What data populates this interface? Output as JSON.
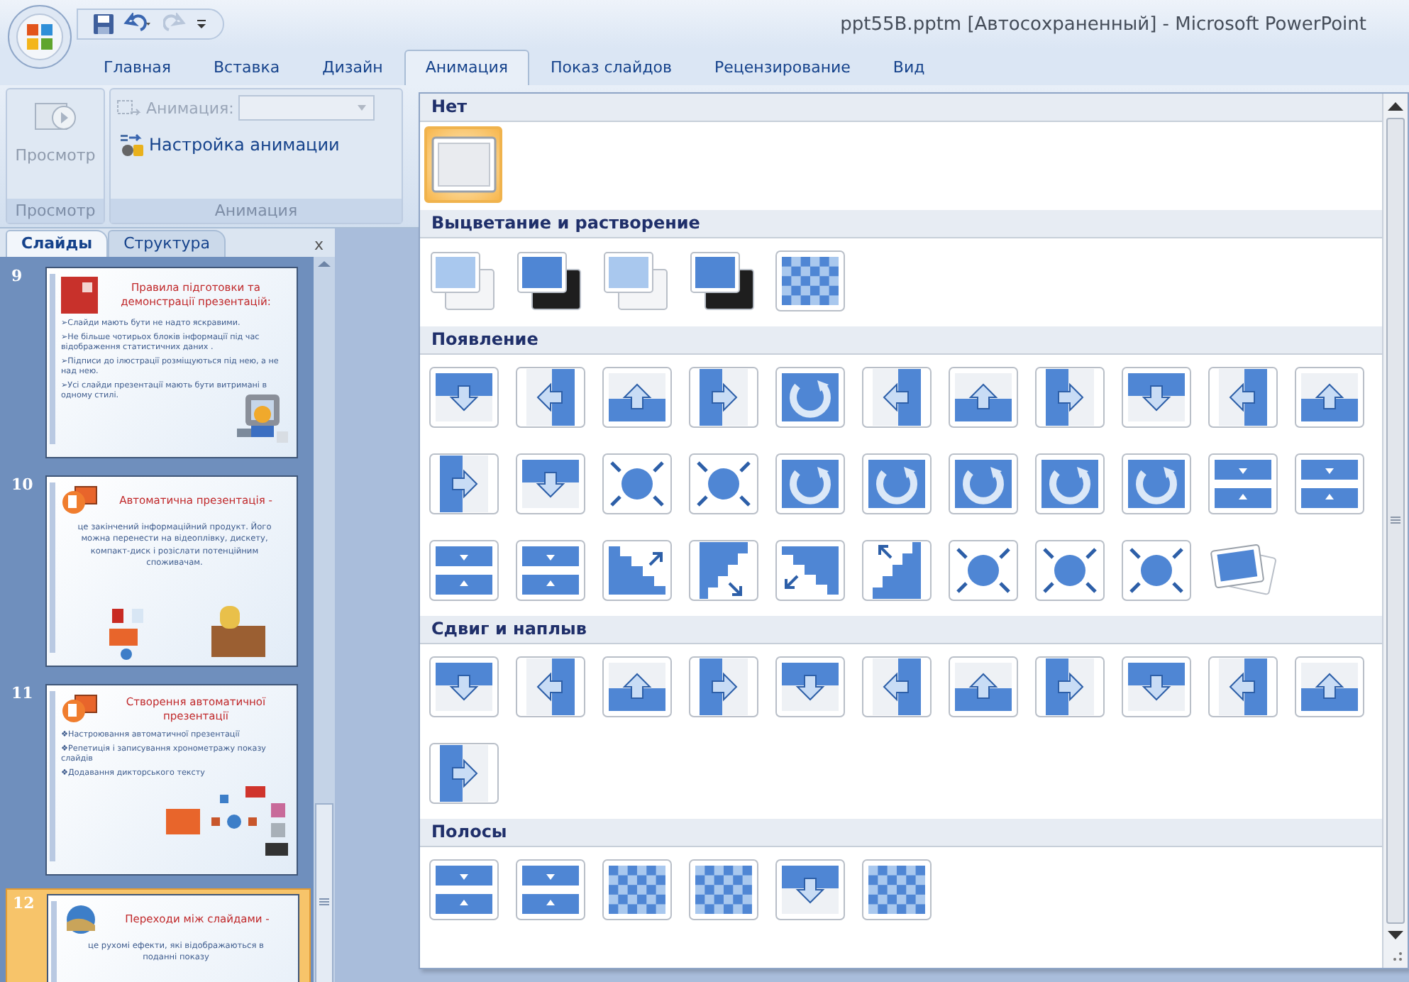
{
  "title_bar": {
    "title": "ppt55B.pptm [Автосохраненный] - Microsoft PowerPoint"
  },
  "ribbon_tabs": [
    {
      "label": "Главная",
      "selected": false
    },
    {
      "label": "Вставка",
      "selected": false
    },
    {
      "label": "Дизайн",
      "selected": false
    },
    {
      "label": "Анимация",
      "selected": true
    },
    {
      "label": "Показ слайдов",
      "selected": false
    },
    {
      "label": "Рецензирование",
      "selected": false
    },
    {
      "label": "Вид",
      "selected": false
    }
  ],
  "ribbon": {
    "groups": [
      {
        "label": "Просмотр",
        "controls": [
          {
            "kind": "large-button",
            "label": "Просмотр",
            "disabled": true
          }
        ]
      },
      {
        "label": "Анимация",
        "controls": [
          {
            "kind": "combo",
            "label": "Анимация:",
            "disabled": true
          },
          {
            "kind": "button",
            "label": "Настройка анимации",
            "disabled": false
          }
        ]
      }
    ]
  },
  "pane": {
    "tabs": [
      {
        "label": "Слайды",
        "selected": true
      },
      {
        "label": "Структура",
        "selected": false
      }
    ],
    "close": "x",
    "slides": [
      {
        "number": "9",
        "selected": false,
        "kind": "bullets",
        "bullet": "➢",
        "title": "Правила підготовки та демонстрації презентацій:",
        "body": [
          "Слайди мають бути не надто яскравими.",
          "Не більше чотирьох блоків інформації під час відображення статистичних даних .",
          "Підписи до ілюстрації розміщуються під нею, а не над нею.",
          "Усі слайди презентації мають бути витримані в одному стилі."
        ]
      },
      {
        "number": "10",
        "selected": false,
        "kind": "paragraph",
        "title": "Автоматична презентація -",
        "body": [
          "це закінчений інформаційний продукт. Його можна перенести на відеоплівку, дискету, компакт-диск і розіслати потенційним споживачам."
        ]
      },
      {
        "number": "11",
        "selected": false,
        "kind": "bullets",
        "bullet": "❖",
        "title": "Створення автоматичної презентації",
        "body": [
          "Настроювання автоматичної презентації",
          "Репетиція і записування хронометражу показу слайдів",
          "Додавання дикторського тексту"
        ]
      },
      {
        "number": "12",
        "selected": true,
        "kind": "paragraph",
        "title": "Переходи між слайдами -",
        "body": [
          "це рухомі ефекти, які відображаються в поданні показу"
        ]
      }
    ]
  },
  "gallery": {
    "sections": [
      {
        "title": "Нет",
        "items": [
          {
            "kind": "none",
            "selected": true
          }
        ]
      },
      {
        "title": "Выцветание и растворение",
        "items": [
          {
            "kind": "layered",
            "selected": false
          },
          {
            "kind": "layered-dark",
            "selected": false
          },
          {
            "kind": "layered",
            "selected": false
          },
          {
            "kind": "layered-dark",
            "selected": false
          },
          {
            "kind": "checker",
            "selected": false
          }
        ]
      },
      {
        "title": "Появление",
        "items": [
          {
            "kind": "arrow",
            "selected": false
          },
          {
            "kind": "arrow",
            "selected": false
          },
          {
            "kind": "arrow",
            "selected": false
          },
          {
            "kind": "arrow",
            "selected": false
          },
          {
            "kind": "wheel",
            "selected": false
          },
          {
            "kind": "arrow",
            "selected": false
          },
          {
            "kind": "arrow",
            "selected": false
          },
          {
            "kind": "arrow",
            "selected": false
          },
          {
            "kind": "arrow",
            "selected": false
          },
          {
            "kind": "arrow",
            "selected": false
          },
          {
            "kind": "arrow",
            "selected": false
          },
          {
            "kind": "arrow",
            "selected": false
          },
          {
            "kind": "arrow",
            "selected": false
          },
          {
            "kind": "shape",
            "selected": false
          },
          {
            "kind": "shape",
            "selected": false
          },
          {
            "kind": "wheel",
            "selected": false
          },
          {
            "kind": "wheel",
            "selected": false
          },
          {
            "kind": "wheel",
            "selected": false
          },
          {
            "kind": "wheel",
            "selected": false
          },
          {
            "kind": "wheel",
            "selected": false
          },
          {
            "kind": "split",
            "selected": false
          },
          {
            "kind": "split",
            "selected": false
          },
          {
            "kind": "split",
            "selected": false
          },
          {
            "kind": "split",
            "selected": false
          },
          {
            "kind": "stairs",
            "selected": false
          },
          {
            "kind": "stairs",
            "selected": false
          },
          {
            "kind": "stairs",
            "selected": false
          },
          {
            "kind": "stairs",
            "selected": false
          },
          {
            "kind": "shape",
            "selected": false
          },
          {
            "kind": "shape",
            "selected": false
          },
          {
            "kind": "shape",
            "selected": false
          },
          {
            "kind": "photos",
            "selected": false
          }
        ]
      },
      {
        "title": "Сдвиг и наплыв",
        "items": [
          {
            "kind": "arrow",
            "selected": false
          },
          {
            "kind": "arrow",
            "selected": false
          },
          {
            "kind": "arrow",
            "selected": false
          },
          {
            "kind": "arrow",
            "selected": false
          },
          {
            "kind": "arrow",
            "selected": false
          },
          {
            "kind": "arrow",
            "selected": false
          },
          {
            "kind": "arrow",
            "selected": false
          },
          {
            "kind": "arrow",
            "selected": false
          },
          {
            "kind": "arrow",
            "selected": false
          },
          {
            "kind": "arrow",
            "selected": false
          },
          {
            "kind": "arrow",
            "selected": false
          },
          {
            "kind": "arrow",
            "selected": false
          }
        ]
      },
      {
        "title": "Полосы",
        "items": [
          {
            "kind": "split",
            "selected": false
          },
          {
            "kind": "split",
            "selected": false
          },
          {
            "kind": "checker",
            "selected": false
          },
          {
            "kind": "checker",
            "selected": false
          },
          {
            "kind": "arrow",
            "selected": false
          },
          {
            "kind": "checker",
            "selected": false
          }
        ]
      }
    ]
  }
}
